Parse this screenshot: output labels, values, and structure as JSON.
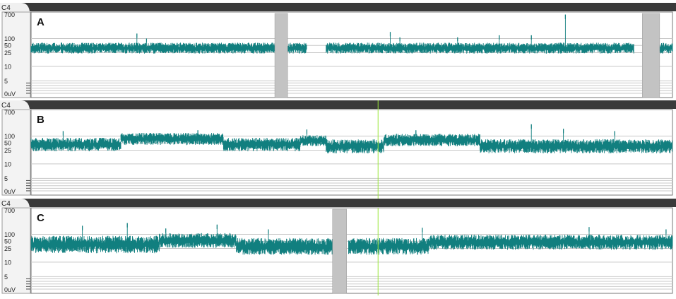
{
  "channel_label": "C4",
  "colors": {
    "trace": "#117f7f",
    "header_bar": "#3a3a3a",
    "tab": "#f0f0f0",
    "axis_panel": "#f3f3f3",
    "gridline": "#c8c8c8",
    "artifact": "#c3c3c3",
    "cursor": "#9ae63a",
    "plot_bg": "#ffffff"
  },
  "chart_data": [
    {
      "type": "line",
      "panel_label": "A",
      "y_scale": "log",
      "ylim": [
        0,
        700
      ],
      "y_ticks": [
        "700",
        "100",
        "50",
        "25",
        "10",
        "5",
        "0uV"
      ],
      "grid": true,
      "series": [
        {
          "envelope_segments": [
            {
              "from": 0.0,
              "to": 0.43,
              "low": 25,
              "high": 60
            },
            {
              "from": 0.46,
              "to": 0.94,
              "low": 25,
              "high": 60
            },
            {
              "from": 0.973,
              "to": 1.0,
              "low": 25,
              "high": 60
            }
          ],
          "peaks": [
            {
              "x": 0.165,
              "value": 150
            },
            {
              "x": 0.18,
              "value": 100
            },
            {
              "x": 0.56,
              "value": 170
            },
            {
              "x": 0.575,
              "value": 110
            },
            {
              "x": 0.665,
              "value": 110
            },
            {
              "x": 0.73,
              "value": 130
            },
            {
              "x": 0.78,
              "value": 130
            },
            {
              "x": 0.833,
              "value": 700
            }
          ]
        }
      ],
      "artifacts": [
        {
          "from": 0.38,
          "to": 0.4
        },
        {
          "from": 0.953,
          "to": 0.98
        }
      ],
      "cursor": null
    },
    {
      "type": "line",
      "panel_label": "B",
      "y_scale": "log",
      "ylim": [
        0,
        700
      ],
      "y_ticks": [
        "700",
        "100",
        "50",
        "25",
        "10",
        "5",
        "0uV"
      ],
      "grid": true,
      "series": [
        {
          "envelope_segments": [
            {
              "from": 0.0,
              "to": 0.14,
              "low": 25,
              "high": 75
            },
            {
              "from": 0.14,
              "to": 0.3,
              "low": 45,
              "high": 120
            },
            {
              "from": 0.3,
              "to": 0.42,
              "low": 25,
              "high": 75
            },
            {
              "from": 0.42,
              "to": 0.46,
              "low": 40,
              "high": 100
            },
            {
              "from": 0.46,
              "to": 0.55,
              "low": 22,
              "high": 65
            },
            {
              "from": 0.55,
              "to": 0.7,
              "low": 40,
              "high": 110
            },
            {
              "from": 0.7,
              "to": 1.0,
              "low": 22,
              "high": 65
            }
          ],
          "peaks": [
            {
              "x": 0.05,
              "value": 150
            },
            {
              "x": 0.26,
              "value": 160
            },
            {
              "x": 0.43,
              "value": 170
            },
            {
              "x": 0.6,
              "value": 160
            },
            {
              "x": 0.78,
              "value": 260
            },
            {
              "x": 0.83,
              "value": 180
            },
            {
              "x": 0.91,
              "value": 150
            }
          ]
        }
      ],
      "artifacts": [],
      "cursor": 0.541
    },
    {
      "type": "line",
      "panel_label": "C",
      "y_scale": "log",
      "ylim": [
        0,
        700
      ],
      "y_ticks": [
        "700",
        "100",
        "50",
        "25",
        "10",
        "5",
        "0uV"
      ],
      "grid": true,
      "series": [
        {
          "envelope_segments": [
            {
              "from": 0.0,
              "to": 0.2,
              "low": 20,
              "high": 75
            },
            {
              "from": 0.2,
              "to": 0.32,
              "low": 30,
              "high": 100
            },
            {
              "from": 0.32,
              "to": 0.47,
              "low": 18,
              "high": 60
            },
            {
              "from": 0.495,
              "to": 0.62,
              "low": 18,
              "high": 60
            },
            {
              "from": 0.62,
              "to": 1.0,
              "low": 25,
              "high": 85
            }
          ],
          "peaks": [
            {
              "x": 0.08,
              "value": 200
            },
            {
              "x": 0.15,
              "value": 250
            },
            {
              "x": 0.21,
              "value": 160
            },
            {
              "x": 0.29,
              "value": 220
            },
            {
              "x": 0.37,
              "value": 150
            },
            {
              "x": 0.61,
              "value": 170
            },
            {
              "x": 0.87,
              "value": 180
            },
            {
              "x": 0.99,
              "value": 150
            }
          ]
        }
      ],
      "artifacts": [
        {
          "from": 0.47,
          "to": 0.492
        }
      ],
      "cursor": 0.541
    }
  ]
}
